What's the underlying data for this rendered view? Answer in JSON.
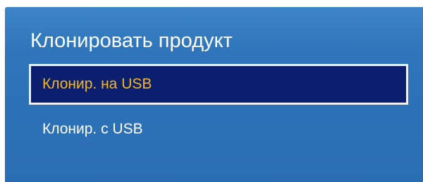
{
  "dialog": {
    "title": "Клонировать продукт"
  },
  "menu": {
    "items": [
      {
        "label": "Клонир. на USB",
        "selected": true
      },
      {
        "label": "Клонир. с USB",
        "selected": false
      }
    ]
  },
  "colors": {
    "panel_background": "#2f75bb",
    "selected_background": "#0c1e6e",
    "selected_border": "#eef2f8",
    "selected_text": "#f5b81c",
    "normal_text": "#ffffff"
  }
}
